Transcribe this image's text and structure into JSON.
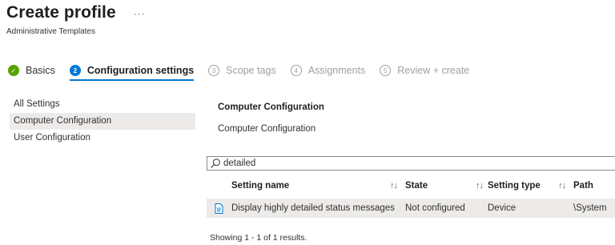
{
  "header": {
    "title": "Create profile",
    "more": "···",
    "subtitle": "Administrative Templates"
  },
  "steps": [
    {
      "label": "Basics",
      "badge": "✓",
      "state": "done"
    },
    {
      "label": "Configuration settings",
      "badge": "2",
      "state": "active"
    },
    {
      "label": "Scope tags",
      "badge": "3",
      "state": "pending"
    },
    {
      "label": "Assignments",
      "badge": "4",
      "state": "pending"
    },
    {
      "label": "Review + create",
      "badge": "5",
      "state": "pending"
    }
  ],
  "left_nav": {
    "items": [
      {
        "label": "All Settings"
      },
      {
        "label": "Computer Configuration",
        "selected": true
      },
      {
        "label": "User Configuration"
      }
    ]
  },
  "content": {
    "heading": "Computer Configuration",
    "subheading": "Computer Configuration",
    "search": {
      "value": "detailed"
    },
    "table": {
      "columns": [
        "Setting name",
        "State",
        "Setting type",
        "Path"
      ],
      "rows": [
        {
          "name": "Display highly detailed status messages",
          "state": "Not configured",
          "type": "Device",
          "path": "\\System"
        }
      ]
    },
    "results_text": "Showing 1 - 1 of 1 results."
  },
  "icons": {
    "sort": "↑↓",
    "search": "search-icon",
    "row": "document-icon",
    "done": "checkmark-icon"
  },
  "colors": {
    "accent": "#0078d4",
    "success": "#57a300",
    "selected_bg": "#edebe9",
    "pending": "#a19f9d"
  }
}
